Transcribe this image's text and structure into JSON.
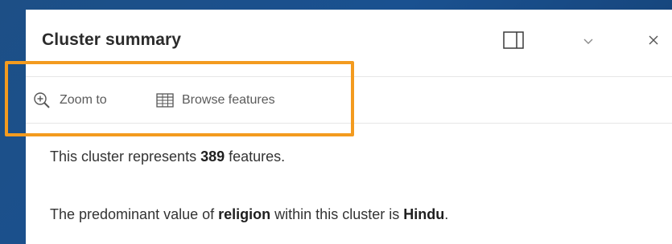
{
  "popup": {
    "title": "Cluster summary",
    "header_buttons": {
      "dock_icon": "dock-icon",
      "collapse_icon": "chevron-down-icon",
      "close_icon": "close-icon"
    },
    "actions": [
      {
        "label": "Zoom to",
        "icon": "zoom-in-icon"
      },
      {
        "label": "Browse features",
        "icon": "table-icon"
      }
    ],
    "content": {
      "line1": {
        "prefix": "This cluster represents ",
        "count": "389",
        "suffix": " features."
      },
      "line2": {
        "prefix": "The predominant value of ",
        "field": "religion",
        "middle": " within this cluster is ",
        "value": "Hindu",
        "suffix": "."
      }
    }
  },
  "colors": {
    "background": "#1a5190",
    "highlight": "#f39b1f",
    "panel": "#ffffff"
  }
}
